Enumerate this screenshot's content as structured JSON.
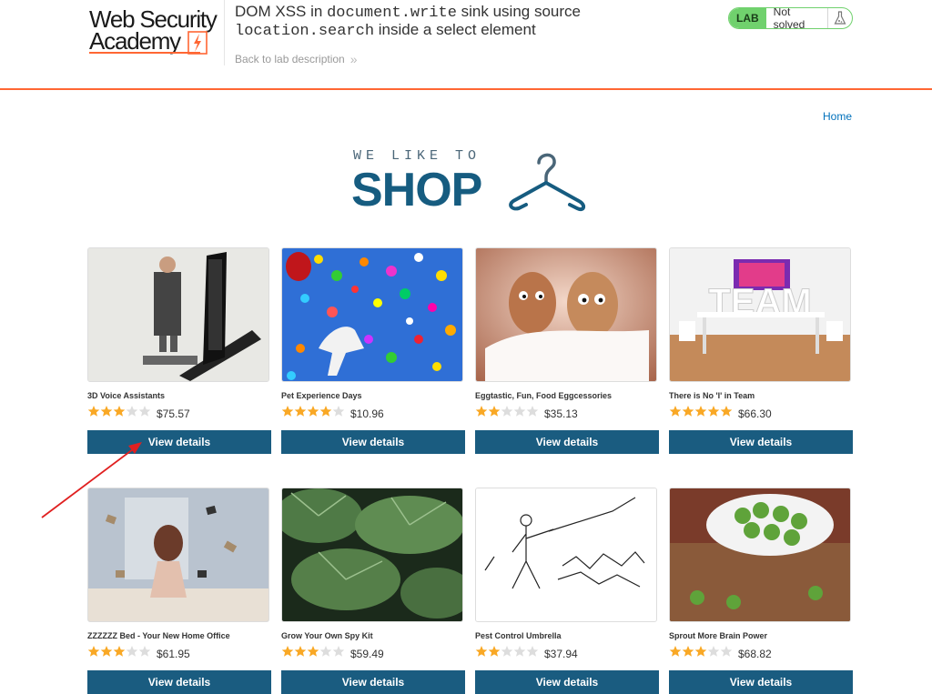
{
  "header": {
    "logo_line1": "Web Security",
    "logo_line2": "Academy",
    "lab_title_1": "DOM XSS in ",
    "lab_title_code1": "document.write",
    "lab_title_2": " sink using source",
    "lab_title_code2": "location.search",
    "lab_title_3": " inside a select element",
    "back_link": "Back to lab description",
    "status_tag": "LAB",
    "status_text": "Not solved"
  },
  "nav": {
    "home": "Home"
  },
  "banner": {
    "tagline": "WE LIKE TO",
    "word": "SHOP"
  },
  "products": [
    {
      "name": "3D Voice Assistants",
      "rating": 3,
      "price": "$75.57",
      "button": "View details"
    },
    {
      "name": "Pet Experience Days",
      "rating": 4,
      "price": "$10.96",
      "button": "View details"
    },
    {
      "name": "Eggtastic, Fun, Food Eggcessories",
      "rating": 2,
      "price": "$35.13",
      "button": "View details"
    },
    {
      "name": "There is No 'I' in Team",
      "rating": 5,
      "price": "$66.30",
      "button": "View details"
    },
    {
      "name": "ZZZZZZ Bed - Your New Home Office",
      "rating": 3,
      "price": "$61.95",
      "button": "View details"
    },
    {
      "name": "Grow Your Own Spy Kit",
      "rating": 3,
      "price": "$59.49",
      "button": "View details"
    },
    {
      "name": "Pest Control Umbrella",
      "rating": 2,
      "price": "$37.94",
      "button": "View details"
    },
    {
      "name": "Sprout More Brain Power",
      "rating": 3,
      "price": "$68.82",
      "button": "View details"
    }
  ],
  "colors": {
    "accent": "#ff6633",
    "button": "#1a5c80",
    "star_on": "#f9a825",
    "star_off": "#dddddd",
    "lab_green": "#70d16d"
  }
}
